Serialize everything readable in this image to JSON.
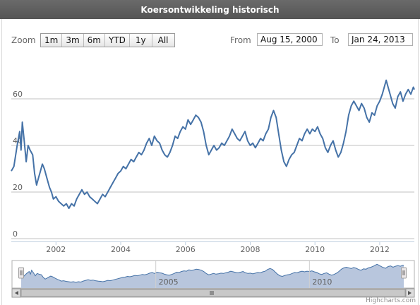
{
  "title": "Koersontwikkeling historisch",
  "zoom": {
    "label": "Zoom",
    "buttons": [
      "1m",
      "3m",
      "6m",
      "YTD",
      "1y",
      "All"
    ]
  },
  "range": {
    "from_label": "From",
    "from_value": "Aug 15, 2000",
    "to_label": "To",
    "to_value": "Jan 24, 2013"
  },
  "credit": "Highcharts.com",
  "colors": {
    "series": "#4572A7",
    "navigator_fill": "#b8c6dd",
    "grid": "#c0c0c0"
  },
  "chart_data": {
    "type": "line",
    "x_start": 2000.62,
    "x_end": 2013.07,
    "ylim": [
      0,
      75
    ],
    "y_ticks": [
      0,
      20,
      40,
      60
    ],
    "x_ticks": [
      2002,
      2004,
      2006,
      2008,
      2010,
      2012
    ],
    "navigator_ticks": [
      2005,
      2010
    ],
    "series": [
      {
        "values_xy": [
          [
            2000.62,
            29
          ],
          [
            2000.7,
            31
          ],
          [
            2000.8,
            40
          ],
          [
            2000.88,
            46
          ],
          [
            2000.92,
            38
          ],
          [
            2000.96,
            50
          ],
          [
            2001.02,
            42
          ],
          [
            2001.08,
            33
          ],
          [
            2001.14,
            40
          ],
          [
            2001.2,
            38
          ],
          [
            2001.28,
            36
          ],
          [
            2001.34,
            28
          ],
          [
            2001.4,
            23
          ],
          [
            2001.46,
            26
          ],
          [
            2001.52,
            29
          ],
          [
            2001.58,
            32
          ],
          [
            2001.64,
            30
          ],
          [
            2001.72,
            26
          ],
          [
            2001.8,
            22
          ],
          [
            2001.86,
            20
          ],
          [
            2001.92,
            17
          ],
          [
            2002.0,
            18
          ],
          [
            2002.08,
            16
          ],
          [
            2002.16,
            15
          ],
          [
            2002.24,
            14
          ],
          [
            2002.32,
            15
          ],
          [
            2002.4,
            13
          ],
          [
            2002.48,
            15
          ],
          [
            2002.56,
            14
          ],
          [
            2002.64,
            17
          ],
          [
            2002.72,
            19
          ],
          [
            2002.8,
            21
          ],
          [
            2002.88,
            19
          ],
          [
            2002.96,
            20
          ],
          [
            2003.04,
            18
          ],
          [
            2003.12,
            17
          ],
          [
            2003.2,
            16
          ],
          [
            2003.28,
            15
          ],
          [
            2003.36,
            17
          ],
          [
            2003.44,
            19
          ],
          [
            2003.52,
            18
          ],
          [
            2003.6,
            20
          ],
          [
            2003.68,
            22
          ],
          [
            2003.76,
            24
          ],
          [
            2003.84,
            26
          ],
          [
            2003.92,
            28
          ],
          [
            2004.0,
            29
          ],
          [
            2004.08,
            31
          ],
          [
            2004.16,
            30
          ],
          [
            2004.24,
            32
          ],
          [
            2004.32,
            34
          ],
          [
            2004.4,
            33
          ],
          [
            2004.48,
            35
          ],
          [
            2004.56,
            37
          ],
          [
            2004.64,
            36
          ],
          [
            2004.72,
            38
          ],
          [
            2004.8,
            41
          ],
          [
            2004.88,
            43
          ],
          [
            2004.96,
            40
          ],
          [
            2005.04,
            44
          ],
          [
            2005.12,
            42
          ],
          [
            2005.2,
            41
          ],
          [
            2005.28,
            38
          ],
          [
            2005.36,
            36
          ],
          [
            2005.44,
            35
          ],
          [
            2005.52,
            37
          ],
          [
            2005.6,
            40
          ],
          [
            2005.68,
            44
          ],
          [
            2005.76,
            43
          ],
          [
            2005.84,
            46
          ],
          [
            2005.92,
            48
          ],
          [
            2006.0,
            47
          ],
          [
            2006.08,
            51
          ],
          [
            2006.16,
            49
          ],
          [
            2006.24,
            51
          ],
          [
            2006.32,
            53
          ],
          [
            2006.4,
            52
          ],
          [
            2006.48,
            50
          ],
          [
            2006.56,
            46
          ],
          [
            2006.64,
            40
          ],
          [
            2006.72,
            36
          ],
          [
            2006.8,
            38
          ],
          [
            2006.88,
            40
          ],
          [
            2006.96,
            38
          ],
          [
            2007.04,
            39
          ],
          [
            2007.12,
            41
          ],
          [
            2007.2,
            40
          ],
          [
            2007.28,
            42
          ],
          [
            2007.36,
            44
          ],
          [
            2007.44,
            47
          ],
          [
            2007.52,
            45
          ],
          [
            2007.6,
            43
          ],
          [
            2007.68,
            42
          ],
          [
            2007.76,
            44
          ],
          [
            2007.84,
            46
          ],
          [
            2007.92,
            42
          ],
          [
            2008.0,
            40
          ],
          [
            2008.08,
            41
          ],
          [
            2008.16,
            39
          ],
          [
            2008.24,
            41
          ],
          [
            2008.32,
            43
          ],
          [
            2008.4,
            42
          ],
          [
            2008.48,
            45
          ],
          [
            2008.56,
            47
          ],
          [
            2008.64,
            52
          ],
          [
            2008.72,
            55
          ],
          [
            2008.8,
            52
          ],
          [
            2008.88,
            45
          ],
          [
            2008.96,
            38
          ],
          [
            2009.04,
            33
          ],
          [
            2009.12,
            31
          ],
          [
            2009.2,
            34
          ],
          [
            2009.28,
            36
          ],
          [
            2009.36,
            37
          ],
          [
            2009.44,
            40
          ],
          [
            2009.52,
            43
          ],
          [
            2009.6,
            42
          ],
          [
            2009.68,
            45
          ],
          [
            2009.76,
            47
          ],
          [
            2009.84,
            45
          ],
          [
            2009.92,
            47
          ],
          [
            2010.0,
            46
          ],
          [
            2010.08,
            48
          ],
          [
            2010.16,
            45
          ],
          [
            2010.24,
            43
          ],
          [
            2010.32,
            39
          ],
          [
            2010.4,
            37
          ],
          [
            2010.48,
            40
          ],
          [
            2010.56,
            42
          ],
          [
            2010.64,
            38
          ],
          [
            2010.72,
            35
          ],
          [
            2010.8,
            37
          ],
          [
            2010.88,
            41
          ],
          [
            2010.96,
            46
          ],
          [
            2011.04,
            53
          ],
          [
            2011.12,
            57
          ],
          [
            2011.2,
            59
          ],
          [
            2011.28,
            57
          ],
          [
            2011.36,
            55
          ],
          [
            2011.44,
            58
          ],
          [
            2011.52,
            56
          ],
          [
            2011.6,
            52
          ],
          [
            2011.68,
            50
          ],
          [
            2011.76,
            54
          ],
          [
            2011.84,
            53
          ],
          [
            2011.92,
            57
          ],
          [
            2012.0,
            59
          ],
          [
            2012.08,
            62
          ],
          [
            2012.16,
            66
          ],
          [
            2012.2,
            68
          ],
          [
            2012.24,
            66
          ],
          [
            2012.32,
            62
          ],
          [
            2012.4,
            58
          ],
          [
            2012.48,
            56
          ],
          [
            2012.56,
            61
          ],
          [
            2012.64,
            63
          ],
          [
            2012.72,
            59
          ],
          [
            2012.8,
            62
          ],
          [
            2012.88,
            64
          ],
          [
            2012.96,
            62
          ],
          [
            2013.04,
            65
          ],
          [
            2013.07,
            64
          ]
        ]
      }
    ]
  }
}
